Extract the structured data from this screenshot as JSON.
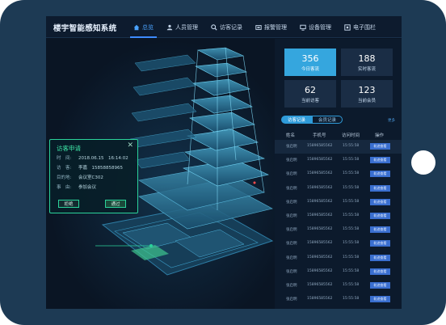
{
  "app": {
    "title": "楼宇智能感知系统"
  },
  "nav": [
    {
      "label": "总览",
      "icon": "home-icon"
    },
    {
      "label": "人员管理",
      "icon": "person-icon"
    },
    {
      "label": "访客记录",
      "icon": "visitor-icon"
    },
    {
      "label": "报警管理",
      "icon": "alarm-icon"
    },
    {
      "label": "设备管理",
      "icon": "device-icon"
    },
    {
      "label": "电子围栏",
      "icon": "fence-icon"
    }
  ],
  "stats": [
    {
      "value": "356",
      "label": "今日客流"
    },
    {
      "value": "188",
      "label": "实时客流"
    },
    {
      "value": "62",
      "label": "当前访客"
    },
    {
      "value": "123",
      "label": "当前会员"
    }
  ],
  "tabs": {
    "active": "访客记录",
    "inactive": "会员记录",
    "more": "更多"
  },
  "table": {
    "headers": {
      "name": "姓名",
      "phone": "手机号",
      "time": "访问时间",
      "action": "操作"
    },
    "rows": [
      {
        "name": "张启明",
        "phone": "15896585562",
        "time": "15:55:58",
        "action": "轨迹查看"
      },
      {
        "name": "张启明",
        "phone": "15896585562",
        "time": "15:55:58",
        "action": "轨迹查看"
      },
      {
        "name": "张启明",
        "phone": "15896585562",
        "time": "15:55:58",
        "action": "轨迹查看"
      },
      {
        "name": "张启明",
        "phone": "15896585562",
        "time": "15:55:58",
        "action": "轨迹查看"
      },
      {
        "name": "张启明",
        "phone": "15896585562",
        "time": "15:55:58",
        "action": "轨迹查看"
      },
      {
        "name": "张启明",
        "phone": "15896585562",
        "time": "15:55:58",
        "action": "轨迹查看"
      },
      {
        "name": "张启明",
        "phone": "15896585562",
        "time": "15:55:58",
        "action": "轨迹查看"
      },
      {
        "name": "张启明",
        "phone": "15896585562",
        "time": "15:55:58",
        "action": "轨迹查看"
      },
      {
        "name": "张启明",
        "phone": "15896585562",
        "time": "15:55:58",
        "action": "轨迹查看"
      },
      {
        "name": "张启明",
        "phone": "15896585562",
        "time": "15:55:58",
        "action": "轨迹查看"
      },
      {
        "name": "张启明",
        "phone": "15896585562",
        "time": "15:55:58",
        "action": "轨迹查看"
      },
      {
        "name": "张启明",
        "phone": "15896585562",
        "time": "15:55:58",
        "action": "轨迹查看"
      }
    ]
  },
  "popup": {
    "title": "访客申请",
    "time_label": "时　间:",
    "time_value": "2018.06.15　16:14:02",
    "visitor_label": "访　客:",
    "visitor_value": "李嘉　15858858965",
    "location_label": "目的地:",
    "location_value": "会议室C302",
    "reason_label": "事　由:",
    "reason_value": "参加会议",
    "reject": "拒绝",
    "pass": "通过"
  },
  "colors": {
    "accent": "#3d8bff",
    "highlight": "#35a6de",
    "popup_border": "#2bd39b"
  }
}
